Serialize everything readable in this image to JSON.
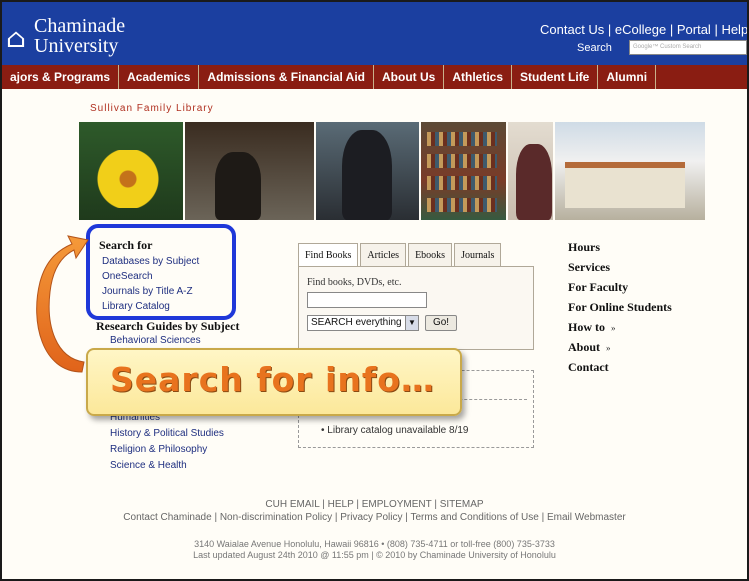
{
  "header": {
    "logo_mark": "⌂",
    "logo_line1": "Chaminade",
    "logo_line2": "University",
    "top_links": [
      "Contact Us",
      "eCollege",
      "Portal",
      "Help"
    ],
    "search_label": "Search",
    "search_placeholder": "Google™ Custom Search"
  },
  "nav": [
    "ajors & Programs",
    "Academics",
    "Admissions & Financial Aid",
    "About Us",
    "Athletics",
    "Student Life",
    "Alumni"
  ],
  "library_title": "Sullivan Family Library",
  "search_for": {
    "title": "Search for",
    "links": [
      "Databases by Subject",
      "OneSearch",
      "Journals by Title A-Z",
      "Library Catalog"
    ]
  },
  "guides": {
    "title": "Research Guides by Subject",
    "items": [
      "Behavioral Sciences",
      "Humanities",
      "History & Political Studies",
      "Religion & Philosophy",
      "Science & Health"
    ]
  },
  "tabs": [
    "Find Books",
    "Articles",
    "Ebooks",
    "Journals"
  ],
  "find_panel": {
    "label": "Find books, DVDs, etc.",
    "select_value": "SEARCH everything",
    "go_label": "Go!"
  },
  "notice": "Library catalog unavailable 8/19",
  "right_links": [
    {
      "label": "Hours",
      "chev": ""
    },
    {
      "label": "Services",
      "chev": ""
    },
    {
      "label": "For Faculty",
      "chev": ""
    },
    {
      "label": "For Online Students",
      "chev": ""
    },
    {
      "label": "How to",
      "chev": "»"
    },
    {
      "label": "About",
      "chev": "»"
    },
    {
      "label": "Contact",
      "chev": ""
    }
  ],
  "callout": "Search for info…",
  "footer": {
    "links": "CUH EMAIL | HELP | EMPLOYMENT | SITEMAP",
    "policy": "Contact Chaminade | Non-discrimination Policy | Privacy Policy | Terms and Conditions of Use | Email Webmaster",
    "address": "3140 Waialae Avenue Honolulu, Hawaii 96816 • (808) 735-4711 or toll-free (800) 735-3733",
    "updated": "Last updated August 24th 2010 @ 11:55 pm | © 2010 by Chaminade University of Honolulu"
  },
  "colors": {
    "header_blue": "#1b3fa0",
    "nav_red": "#8a1d12",
    "highlight_blue": "#1f38d9",
    "callout_orange": "#e8731e"
  }
}
